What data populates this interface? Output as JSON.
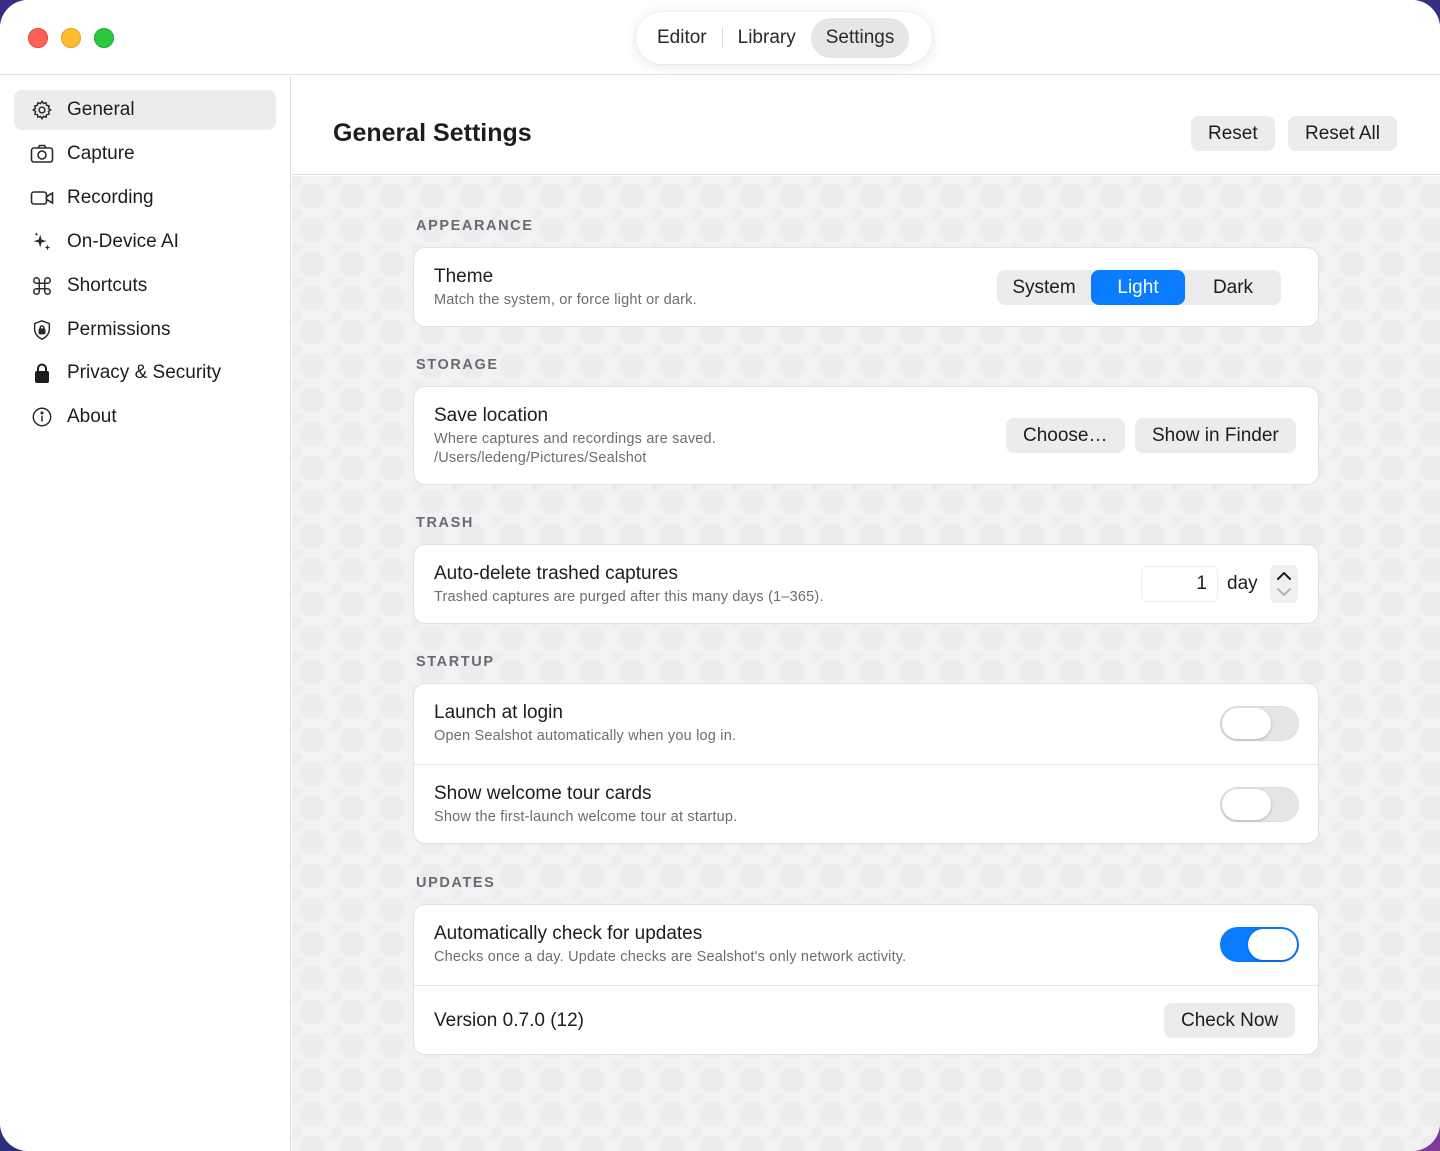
{
  "window": {
    "nav_tabs": [
      {
        "label": "Editor",
        "active": false
      },
      {
        "label": "Library",
        "active": false
      },
      {
        "label": "Settings",
        "active": true
      }
    ]
  },
  "sidebar": {
    "items": [
      {
        "label": "General",
        "icon": "gear-icon",
        "active": true
      },
      {
        "label": "Capture",
        "icon": "camera-icon",
        "active": false
      },
      {
        "label": "Recording",
        "icon": "video-camera-icon",
        "active": false
      },
      {
        "label": "On-Device AI",
        "icon": "sparkles-icon",
        "active": false
      },
      {
        "label": "Shortcuts",
        "icon": "command-icon",
        "active": false
      },
      {
        "label": "Permissions",
        "icon": "lock-shield-icon",
        "active": false
      },
      {
        "label": "Privacy & Security",
        "icon": "lock-icon",
        "active": false
      },
      {
        "label": "About",
        "icon": "info-icon",
        "active": false
      }
    ]
  },
  "header": {
    "title": "General Settings",
    "reset_label": "Reset",
    "reset_all_label": "Reset All"
  },
  "sections": {
    "appearance": {
      "label": "APPEARANCE",
      "theme": {
        "title": "Theme",
        "description": "Match the system, or force light or dark.",
        "options": [
          "System",
          "Light",
          "Dark"
        ],
        "selected": "Light"
      }
    },
    "storage": {
      "label": "STORAGE",
      "save_location": {
        "title": "Save location",
        "description": "Where captures and recordings are saved. /Users/ledeng/Pictures/Sealshot",
        "choose_label": "Choose…",
        "show_in_finder_label": "Show in Finder"
      }
    },
    "trash": {
      "label": "TRASH",
      "auto_delete": {
        "title": "Auto-delete trashed captures",
        "description": "Trashed captures are purged after this many days (1–365).",
        "value": "1",
        "unit": "day"
      }
    },
    "startup": {
      "label": "STARTUP",
      "launch_at_login": {
        "title": "Launch at login",
        "description": "Open Sealshot automatically when you log in.",
        "enabled": false
      },
      "welcome_tour": {
        "title": "Show welcome tour cards",
        "description": "Show the first-launch welcome tour at startup.",
        "enabled": false
      }
    },
    "updates": {
      "label": "UPDATES",
      "auto_check": {
        "title": "Automatically check for updates",
        "description": "Checks once a day. Update checks are Sealshot's only network activity.",
        "enabled": true
      },
      "version": {
        "text": "Version 0.7.0 (12)",
        "check_now_label": "Check Now"
      }
    }
  },
  "colors": {
    "accent": "#0a7cff",
    "traffic_red": "#fe5f57",
    "traffic_yellow": "#febc2e",
    "traffic_green": "#28c840"
  }
}
